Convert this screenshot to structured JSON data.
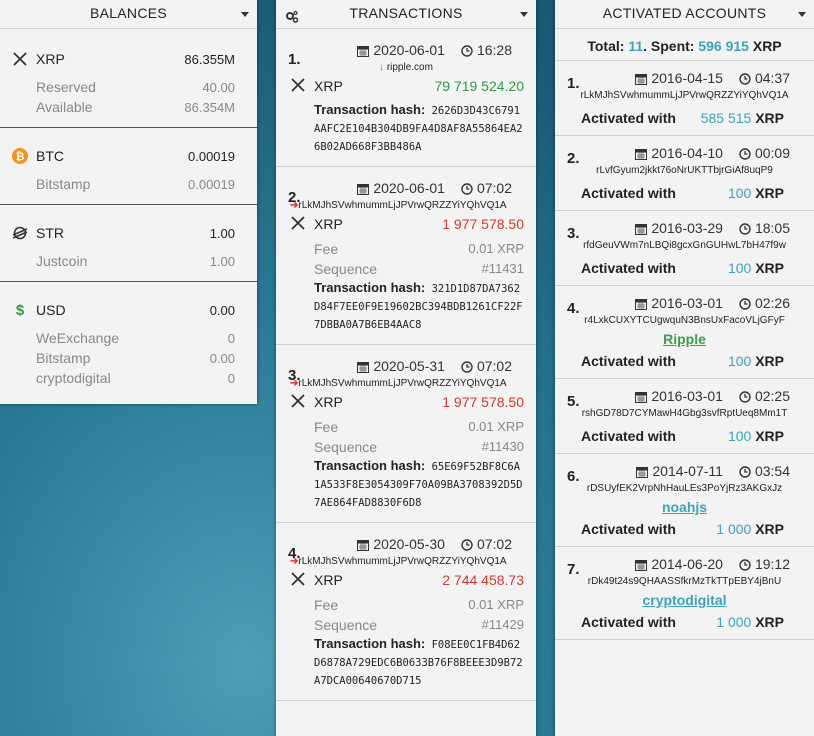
{
  "balances": {
    "title": "BALANCES",
    "groups": [
      {
        "icon": "xrp-icon",
        "name": "XRP",
        "value": "86.355M",
        "sub": [
          {
            "label": "Reserved",
            "value": "40.00"
          },
          {
            "label": "Available",
            "value": "86.354M"
          }
        ]
      },
      {
        "icon": "btc-icon",
        "name": "BTC",
        "value": "0.00019",
        "sub": [
          {
            "label": "Bitstamp",
            "value": "0.00019"
          }
        ]
      },
      {
        "icon": "stellar-icon",
        "name": "STR",
        "value": "1.00",
        "sub": [
          {
            "label": "Justcoin",
            "value": "1.00"
          }
        ]
      },
      {
        "icon": "dollar-icon",
        "name": "USD",
        "value": "0.00",
        "sub": [
          {
            "label": "WeExchange",
            "value": "0"
          },
          {
            "label": "Bitstamp",
            "value": "0.00"
          },
          {
            "label": "cryptodigital",
            "value": "0"
          }
        ]
      }
    ]
  },
  "transactions": {
    "title": "TRANSACTIONS",
    "items": [
      {
        "num": "1.",
        "date": "2020-06-01",
        "time": "16:28",
        "direction": "in",
        "source": "ripple.com",
        "currency": "XRP",
        "amount": "79 719 524.20",
        "hash_label": "Transaction hash:",
        "hash": "2626D3D43C6791AAFC2E104B304DB9FA4D8AF8A55864EA26B02AD668F3BB486A"
      },
      {
        "num": "2.",
        "date": "2020-06-01",
        "time": "07:02",
        "direction": "out",
        "source": "rLkMJhSVwhmummLjJPVrwQRZZYiYQhVQ1A",
        "currency": "XRP",
        "amount": "1 977 578.50",
        "fee_label": "Fee",
        "fee": "0.01 XRP",
        "seq_label": "Sequence",
        "sequence": "#11431",
        "hash_label": "Transaction hash:",
        "hash": "321D1D87DA7362D84F7EE0F9E19602BC394BDB1261CF22F7DBBA0A7B6EB4AAC8"
      },
      {
        "num": "3.",
        "date": "2020-05-31",
        "time": "07:02",
        "direction": "out",
        "source": "rLkMJhSVwhmummLjJPVrwQRZZYiYQhVQ1A",
        "currency": "XRP",
        "amount": "1 977 578.50",
        "fee_label": "Fee",
        "fee": "0.01 XRP",
        "seq_label": "Sequence",
        "sequence": "#11430",
        "hash_label": "Transaction hash:",
        "hash": "65E69F52BF8C6A1A533F8E3054309F70A09BA3708392D5D7AE864FAD8830F6D8"
      },
      {
        "num": "4.",
        "date": "2020-05-30",
        "time": "07:02",
        "direction": "out",
        "source": "rLkMJhSVwhmummLjJPVrwQRZZYiYQhVQ1A",
        "currency": "XRP",
        "amount": "2 744 458.73",
        "fee_label": "Fee",
        "fee": "0.01 XRP",
        "seq_label": "Sequence",
        "sequence": "#11429",
        "hash_label": "Transaction hash:",
        "hash": "F08EE0C1FB4D62D6878A729EDC6B0633B76F8BEEE3D9B72A7DCA00640670D715"
      }
    ]
  },
  "activated": {
    "title": "ACTIVATED ACCOUNTS",
    "total_label": "Total:",
    "total": "11",
    "spent_label": "Spent:",
    "spent": "596 915",
    "spent_currency": "XRP",
    "with_label": "Activated with",
    "items": [
      {
        "num": "1.",
        "date": "2016-04-15",
        "time": "04:37",
        "address": "rLkMJhSVwhmummLjJPVrwQRZZYiYQhVQ1A",
        "name": "",
        "amount": "585 515",
        "currency": "XRP"
      },
      {
        "num": "2.",
        "date": "2016-04-10",
        "time": "00:09",
        "address": "rLvfGyum2jkkt76oNrUKTTbjrGiAf8uqP9",
        "name": "",
        "amount": "100",
        "currency": "XRP"
      },
      {
        "num": "3.",
        "date": "2016-03-29",
        "time": "18:05",
        "address": "rfdGeuVWm7nLBQi8gcxGnGUHwL7bH47f9w",
        "name": "",
        "amount": "100",
        "currency": "XRP"
      },
      {
        "num": "4.",
        "date": "2016-03-01",
        "time": "02:26",
        "address": "r4LxkCUXYTCUgwquN3BnsUxFacoVLjGFyF",
        "name": "Ripple",
        "name_color": "green",
        "amount": "100",
        "currency": "XRP"
      },
      {
        "num": "5.",
        "date": "2016-03-01",
        "time": "02:25",
        "address": "rshGD78D7CYMawH4Gbg3svfRptUeq8Mm1T",
        "name": "",
        "amount": "100",
        "currency": "XRP"
      },
      {
        "num": "6.",
        "date": "2014-07-11",
        "time": "03:54",
        "address": "rDSUyfEK2VrpNhHauLEs3PoYjRz3AKGxJz",
        "name": "noahjs",
        "name_color": "teal",
        "amount": "1 000",
        "currency": "XRP"
      },
      {
        "num": "7.",
        "date": "2014-06-20",
        "time": "19:12",
        "address": "rDk49t24s9QHAASSfkrMzTkTTpEBY4jBnU",
        "name": "cryptodigital",
        "name_color": "teal",
        "amount": "1 000",
        "currency": "XRP"
      }
    ]
  }
}
